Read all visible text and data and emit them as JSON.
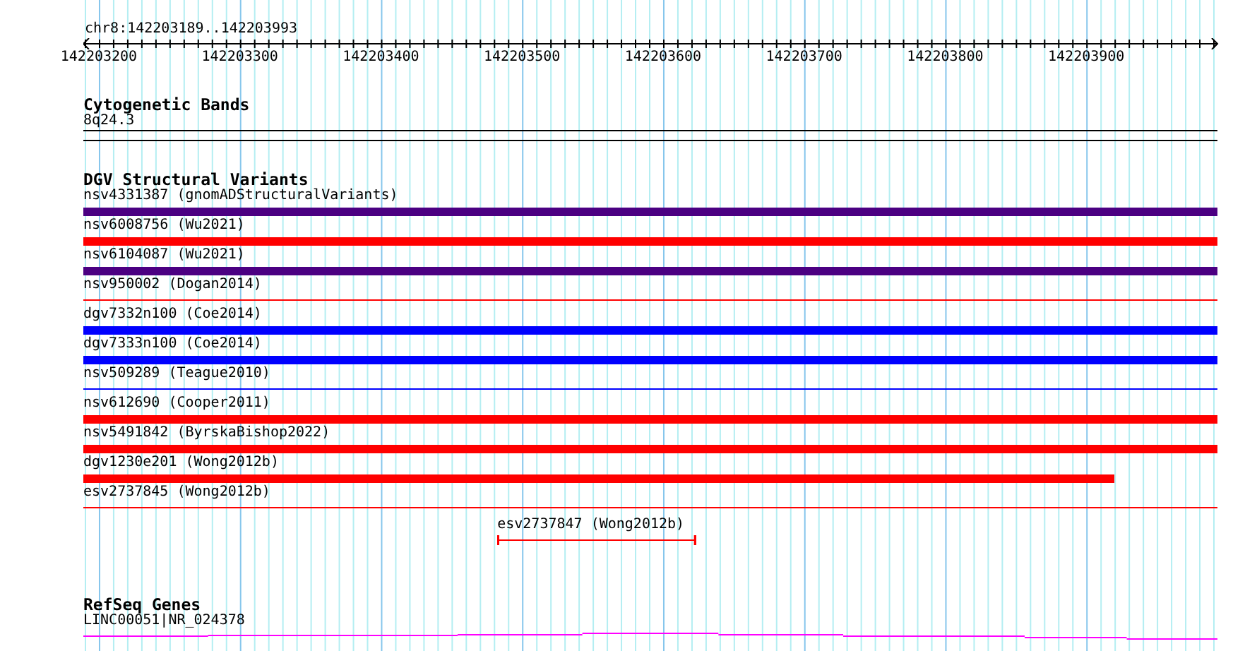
{
  "ruler": {
    "location": "chr8:142203189..142203993",
    "ticks": [
      "142203200",
      "142203300",
      "142203400",
      "142203500",
      "142203600",
      "142203700",
      "142203800",
      "142203900"
    ]
  },
  "cytogenetic_bands": {
    "title": "Cytogenetic Bands",
    "bands": [
      {
        "label": "8q24.3"
      }
    ]
  },
  "dgv_structural_variants": {
    "title": "DGV Structural Variants",
    "variants": [
      {
        "label": "nsv4331387 (gnomADStructuralVariants)",
        "kind": "thick",
        "color": "#4b0082"
      },
      {
        "label": "nsv6008756 (Wu2021)",
        "kind": "thick",
        "color": "#ff0000"
      },
      {
        "label": "nsv6104087 (Wu2021)",
        "kind": "thick",
        "color": "#4b0082"
      },
      {
        "label": "nsv950002 (Dogan2014)",
        "kind": "thin",
        "color": "#ff0000"
      },
      {
        "label": "dgv7332n100 (Coe2014)",
        "kind": "thick",
        "color": "#0000ff"
      },
      {
        "label": "dgv7333n100 (Coe2014)",
        "kind": "thick",
        "color": "#0000ff"
      },
      {
        "label": "nsv509289 (Teague2010)",
        "kind": "thin",
        "color": "#0000ff"
      },
      {
        "label": "nsv612690 (Cooper2011)",
        "kind": "thick",
        "color": "#ff0000"
      },
      {
        "label": "nsv5491842 (ByrskaBishop2022)",
        "kind": "thick",
        "color": "#ff0000"
      },
      {
        "label": "dgv1230e201 (Wong2012b)",
        "kind": "thick",
        "color": "#ff0000"
      },
      {
        "label": "esv2737845 (Wong2012b)",
        "kind": "thin",
        "color": "#ff0000"
      },
      {
        "label": "esv2737847 (Wong2012b)",
        "kind": "capped",
        "color": "#ff0000"
      }
    ]
  },
  "refseq_genes": {
    "title": "RefSeq Genes",
    "genes": [
      {
        "label": "LINC00051|NR_024378"
      }
    ]
  }
}
